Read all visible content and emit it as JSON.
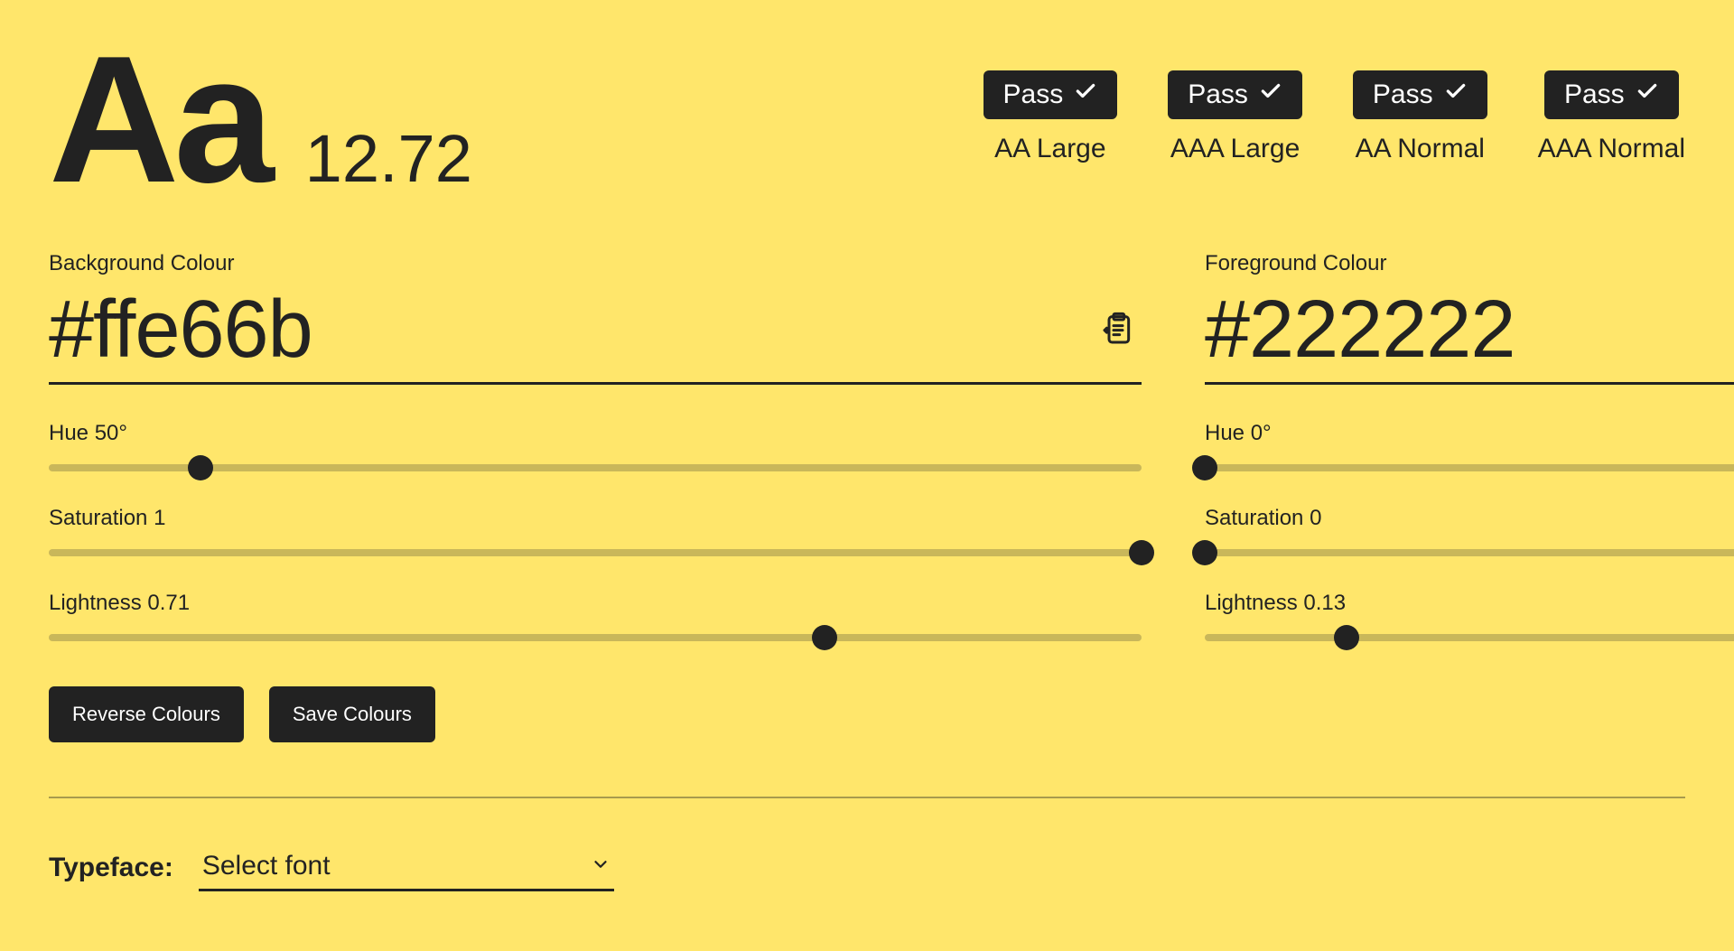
{
  "sample_text": "Aa",
  "contrast_ratio": "12.72",
  "wcag": [
    {
      "result": "Pass",
      "label": "AA Large"
    },
    {
      "result": "Pass",
      "label": "AAA Large"
    },
    {
      "result": "Pass",
      "label": "AA Normal"
    },
    {
      "result": "Pass",
      "label": "AAA Normal"
    }
  ],
  "background": {
    "heading": "Background Colour",
    "hex": "#ffe66b",
    "hue_label": "Hue 50°",
    "hue_pct": 13.9,
    "sat_label": "Saturation 1",
    "sat_pct": 100,
    "light_label": "Lightness 0.71",
    "light_pct": 71
  },
  "foreground": {
    "heading": "Foreground Colour",
    "hex": "#222222",
    "hue_label": "Hue 0°",
    "hue_pct": 0,
    "sat_label": "Saturation 0",
    "sat_pct": 0,
    "light_label": "Lightness 0.13",
    "light_pct": 13
  },
  "buttons": {
    "reverse": "Reverse Colours",
    "save": "Save Colours"
  },
  "typeface": {
    "label": "Typeface:",
    "placeholder": "Select font"
  }
}
